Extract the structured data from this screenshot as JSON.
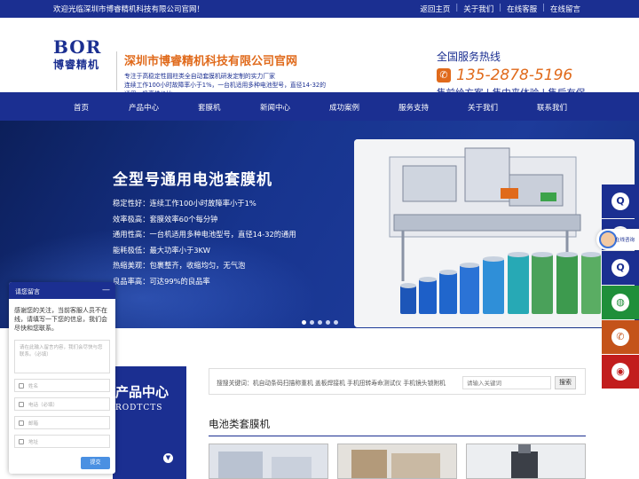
{
  "topbar": {
    "welcome": "欢迎光临深圳市博睿精机科技有限公司官网！",
    "links": [
      "返回主页",
      "关于我们",
      "在线客服",
      "在线留言"
    ]
  },
  "header": {
    "logo_en": "BOR",
    "logo_cn": "博睿精机",
    "company_name": "深圳市博睿精机科技有限公司官网",
    "desc_line1": "专注于高稳定性圆柱类全自动套膜机研发定制的实力厂家",
    "desc_line2": "连续工作100小时故障率小于1%，一台机适用多种电池型号，直径14-32的通用，极高性价比。",
    "hotline_title": "全国服务热线",
    "hotline_number": "135-2878-5196",
    "service_text": "售前给方案 | 售中来体验 | 售后有保障"
  },
  "nav": {
    "items": [
      "首页",
      "产品中心",
      "套膜机",
      "新闻中心",
      "成功案例",
      "服务支持",
      "关于我们",
      "联系我们"
    ]
  },
  "banner": {
    "title": "全型号通用电池套膜机",
    "features": [
      "稳定性好：连续工作100小时故障率小于1%",
      "效率极高：套膜效率60个每分钟",
      "通用性高：一台机适用多种电池型号，直径14-32的通用",
      "能耗极低：最大功率小于3KW",
      "热缩美观：包裹整齐，收缩均匀，无气泡",
      "良品率高：可达99%的良品率"
    ],
    "slide_count": 5,
    "active_slide": 1
  },
  "product_center": {
    "title": "产品中心",
    "subtitle": "RODTCTS"
  },
  "search": {
    "keywords_label": "搜搜关键词：机自动条码扫描称重机 盖板焊接机 手机扭转寿命测试仪 手机镜头锁附机",
    "placeholder": "请输入关键词",
    "button": "搜索"
  },
  "section": {
    "title": "电池类套膜机"
  },
  "chat": {
    "header": "请您留言",
    "minimize": "—",
    "message": "感谢您的关注，当前客服人员不在线，请填写一下您的信息，我们会尽快和您联系。",
    "textarea_placeholder": "请在此输入留言内容，我们会尽快与您联系。（必填）",
    "name_placeholder": "姓名",
    "phone_placeholder": "电话（必填）",
    "email_placeholder": "邮箱",
    "address_placeholder": "地址",
    "submit": "提交"
  },
  "rightbar": {
    "online_label": "在线咨询",
    "buttons": [
      {
        "icon": "qq-icon",
        "color": "#1b2f91"
      },
      {
        "icon": "qq-icon",
        "color": "#1b2f91"
      },
      {
        "icon": "qq-icon",
        "color": "#1b2f91"
      },
      {
        "icon": "wechat-icon",
        "color": "#1f8f3a"
      },
      {
        "icon": "phone-icon",
        "color": "#c4531a"
      },
      {
        "icon": "weibo-icon",
        "color": "#c21d1d"
      }
    ]
  }
}
